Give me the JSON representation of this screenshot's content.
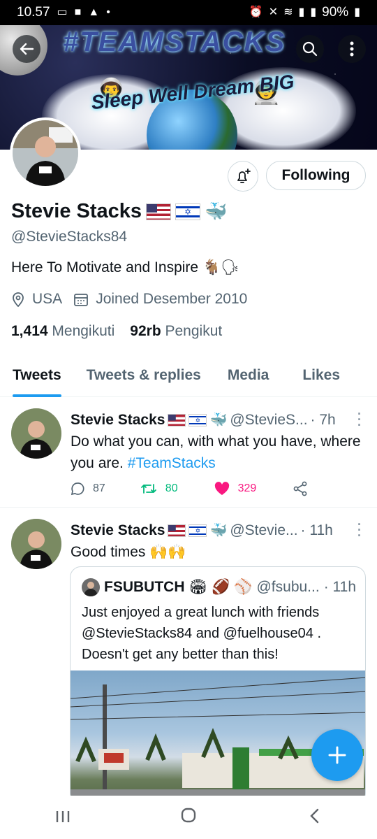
{
  "status_bar": {
    "time": "10.57",
    "battery": "90%"
  },
  "banner": {
    "title": "#TEAMSTACKS",
    "motto": "Sleep Well Dream BIG"
  },
  "header_actions": {
    "back_icon": "back-arrow-icon",
    "search_icon": "search-icon",
    "more_icon": "more-vertical-icon"
  },
  "profile": {
    "name": "Stevie Stacks",
    "handle": "@StevieStacks84",
    "bio": "Here To Motivate and Inspire",
    "location": "USA",
    "joined": "Joined Desember 2010",
    "following_count": "1,414",
    "following_label": "Mengikuti",
    "followers_count": "92rb",
    "followers_label": "Pengikut",
    "follow_button": "Following",
    "notify_icon": "bell-plus-icon"
  },
  "tabs": [
    {
      "label": "Tweets",
      "active": true
    },
    {
      "label": "Tweets & replies",
      "active": false
    },
    {
      "label": "Media",
      "active": false
    },
    {
      "label": "Likes",
      "active": false
    }
  ],
  "tweets": [
    {
      "name": "Stevie Stacks",
      "handle": "@StevieS...",
      "time": "· 7h",
      "text": "Do what you can, with what you have, where you are.",
      "hashtag": "#TeamStacks",
      "replies": "87",
      "retweets": "80",
      "likes": "329"
    },
    {
      "name": "Stevie Stacks",
      "handle": "@Stevie...",
      "time": "· 11h",
      "text": "Good times 🙌🙌",
      "quote": {
        "name": "FSUBUTCH",
        "handle": "@fsubu...",
        "time": "· 11h",
        "text": "Just enjoyed a great lunch with friends @StevieStacks84 and @fuelhouse04 . Doesn't get any better than this!"
      }
    }
  ],
  "colors": {
    "accent": "#1d9bf0",
    "like": "#f91880",
    "retweet": "#00ba7c",
    "muted": "#536471"
  }
}
